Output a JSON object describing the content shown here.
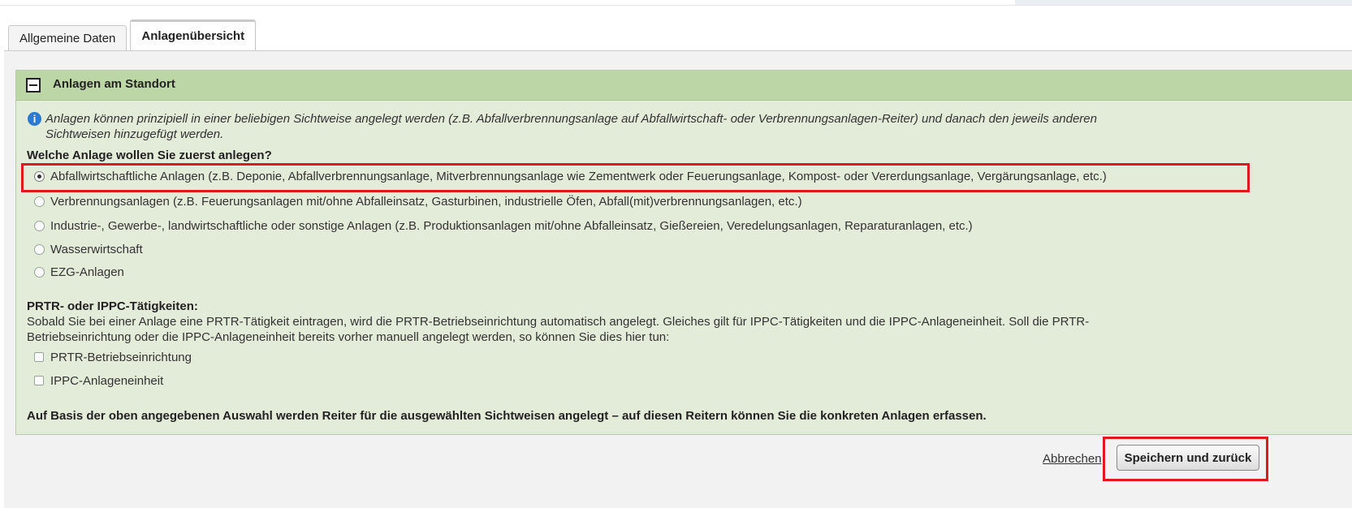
{
  "tabs": [
    {
      "label": "Allgemeine Daten",
      "active": false
    },
    {
      "label": "Anlagenübersicht",
      "active": true
    }
  ],
  "section": {
    "title": "Anlagen am Standort",
    "info_line1": "Anlagen können prinzipiell in einer beliebigen Sichtweise angelegt werden (z.B. Abfallverbrennungsanlage auf Abfallwirtschaft- oder Verbrennungsanlagen-Reiter) und danach den jeweils anderen",
    "info_line2": "Sichtweisen hinzugefügt werden.",
    "question": "Welche Anlage wollen Sie zuerst anlegen?",
    "options": [
      {
        "label": "Abfallwirtschaftliche Anlagen (z.B. Deponie, Abfallverbrennungsanlage, Mitverbrennungsanlage wie Zementwerk oder Feuerungsanlage, Kompost- oder Vererdungsanlage, Vergärungsanlage, etc.)",
        "selected": true
      },
      {
        "label": "Verbrennungsanlagen (z.B. Feuerungsanlagen mit/ohne Abfalleinsatz, Gasturbinen, industrielle Öfen, Abfall(mit)verbrennungsanlagen, etc.)",
        "selected": false
      },
      {
        "label": "Industrie-, Gewerbe-, landwirtschaftliche oder sonstige Anlagen (z.B. Produktionsanlagen mit/ohne Abfalleinsatz, Gießereien, Veredelungsanlagen, Reparaturanlagen, etc.)",
        "selected": false
      },
      {
        "label": "Wasserwirtschaft",
        "selected": false
      },
      {
        "label": "EZG-Anlagen",
        "selected": false
      }
    ],
    "prtr_title": "PRTR- oder IPPC-Tätigkeiten:",
    "prtr_line1": "Sobald Sie bei einer Anlage eine PRTR-Tätigkeit eintragen, wird die PRTR-Betriebseinrichtung automatisch angelegt. Gleiches gilt für IPPC-Tätigkeiten und die IPPC-Anlageneinheit. Soll die PRTR-",
    "prtr_line2": "Betriebseinrichtung oder die IPPC-Anlageneinheit bereits vorher manuell angelegt werden, so können Sie dies hier tun:",
    "checkboxes": [
      {
        "label": "PRTR-Betriebseinrichtung",
        "checked": false
      },
      {
        "label": "IPPC-Anlageneinheit",
        "checked": false
      }
    ],
    "final_note": "Auf Basis der oben angegebenen Auswahl werden Reiter für die ausgewählten Sichtweisen angelegt – auf diesen Reitern können Sie die konkreten Anlagen erfassen."
  },
  "actions": {
    "cancel_label": "Abbrechen",
    "save_label": "Speichern und zurück"
  },
  "colors": {
    "section_header": "#bdd6a6",
    "section_body": "#e3ecd9",
    "highlight": "#e0191f",
    "info_icon": "#2a7bd1"
  },
  "icons": {
    "info": "info-icon",
    "collapse": "minus-box-icon"
  }
}
